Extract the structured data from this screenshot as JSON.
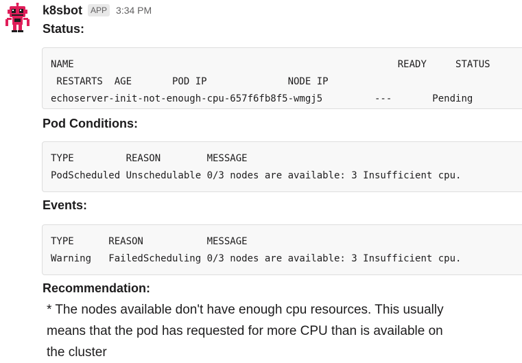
{
  "message": {
    "bot_name": "k8sbot",
    "badge": "APP",
    "timestamp": "3:34 PM"
  },
  "avatar_icon": "robot-avatar-icon",
  "colors": {
    "avatar_red": "#e01e5a",
    "code_bg": "#f8f8f8",
    "code_border": "#dddddd"
  },
  "status": {
    "title": "Status:",
    "lines": [
      "NAME                                                        READY     STATUS",
      " RESTARTS  AGE       POD IP              NODE IP",
      "echoserver-init-not-enough-cpu-657f6fb8f5-wmgj5         ---       Pending"
    ]
  },
  "pod_conditions": {
    "title": "Pod Conditions:",
    "lines": [
      "TYPE         REASON        MESSAGE",
      "PodScheduled Unschedulable 0/3 nodes are available: 3 Insufficient cpu."
    ]
  },
  "events": {
    "title": "Events:",
    "lines": [
      "TYPE      REASON           MESSAGE",
      "Warning   FailedScheduling 0/3 nodes are available: 3 Insufficient cpu."
    ]
  },
  "recommendation": {
    "title": "Recommendation:",
    "lines": [
      "* The nodes available don't have enough cpu resources.  This usually",
      "means that the pod has requested for more CPU than is available on",
      "the cluster"
    ]
  }
}
